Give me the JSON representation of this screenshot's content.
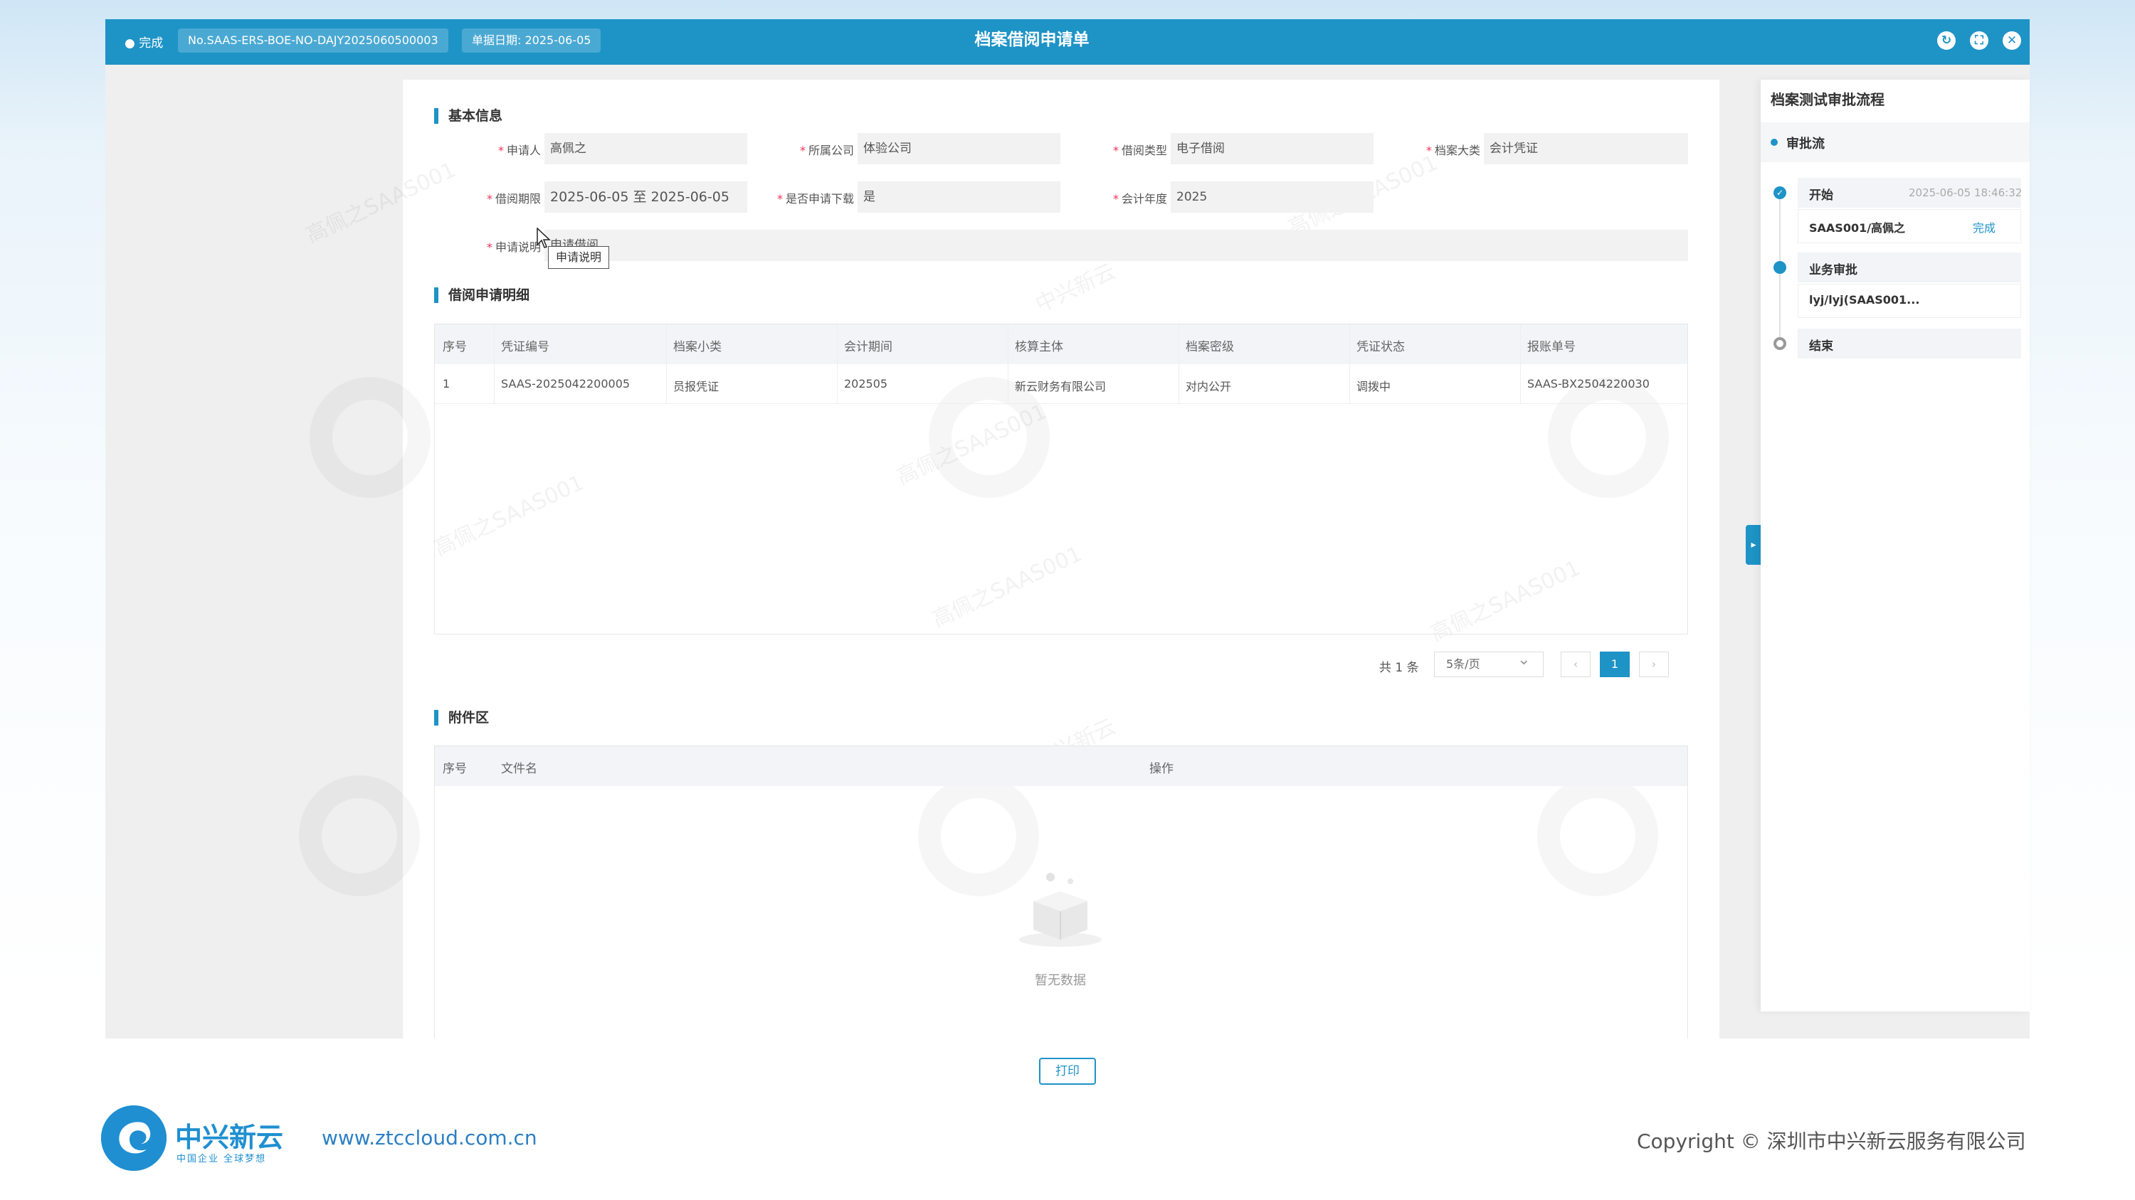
{
  "titlebar": {
    "status": "● 完成",
    "doc_no": "No.SAAS-ERS-BOE-NO-DAJY2025060500003",
    "doc_date": "单据日期: 2025-06-05",
    "title": "档案借阅申请单",
    "controls": [
      "refresh-icon",
      "fullscreen-icon",
      "close-icon"
    ]
  },
  "basic": {
    "section_title": "基本信息",
    "applicant_label": "申请人",
    "applicant": "高佩之",
    "company_label": "所属公司",
    "company": "体验公司",
    "borrow_type_label": "借阅类型",
    "borrow_type": "电子借阅",
    "archive_category_label": "档案大类",
    "archive_category": "会计凭证",
    "period_label": "借阅期限",
    "period": "2025-06-05 至 2025-06-05",
    "download_label": "是否申请下载",
    "download": "是",
    "fiscal_year_label": "会计年度",
    "fiscal_year": "2025",
    "desc_label": "申请说明",
    "desc_value": "申请借阅",
    "tooltip": "申请说明"
  },
  "detail": {
    "section_title": "借阅申请明细",
    "columns": [
      "序号",
      "凭证编号",
      "档案小类",
      "会计期间",
      "核算主体",
      "档案密级",
      "凭证状态",
      "报账单号"
    ],
    "rows": [
      [
        "1",
        "SAAS-2025042200005",
        "员报凭证",
        "202505",
        "新云财务有限公司",
        "对内公开",
        "调拨中",
        "SAAS-BX2504220030"
      ]
    ],
    "total": "共 1 条",
    "page_size": "5条/页",
    "current_page": "1",
    "prev_label": "‹",
    "next_label": "›",
    "select_arrow": "⌄"
  },
  "attachments": {
    "section_title": "附件区",
    "columns": [
      "序号",
      "文件名",
      "操作"
    ],
    "empty_text": "暂无数据"
  },
  "print_label": "打印",
  "flow": {
    "title": "档案测试审批流程",
    "subtitle": "审批流",
    "steps": [
      {
        "name": "开始",
        "time": "2025-06-05 18:46:32",
        "user": "SAAS001/高佩之",
        "status": "完成"
      },
      {
        "name": "业务审批",
        "user": "lyj/lyj(SAAS001..."
      },
      {
        "name": "结束"
      }
    ],
    "toggle_glyph": "▸"
  },
  "watermark": {
    "text": "高佩之SAAS001",
    "brand": "中兴新云"
  },
  "footer": {
    "brand": "中兴新云",
    "slogan": "中国企业 全球梦想",
    "url": "www.ztccloud.com.cn",
    "copyright": "Copyright © 深圳市中兴新云服务有限公司"
  },
  "colors": {
    "primary": "#1e93c6",
    "status_done": "#1e93c6"
  }
}
